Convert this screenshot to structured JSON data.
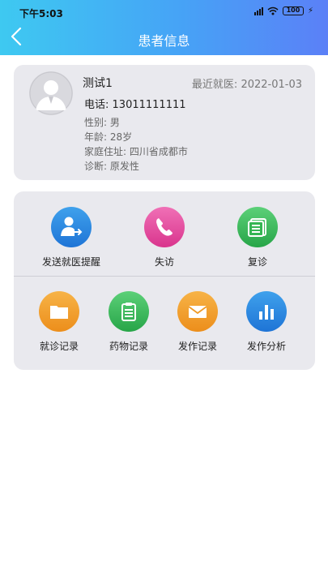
{
  "status_bar": {
    "time": "下午5:03",
    "battery": "100"
  },
  "header": {
    "title": "患者信息",
    "back_icon": "chevron-left-icon"
  },
  "patient": {
    "name": "测试1",
    "last_visit_label": "最近就医:",
    "last_visit_date": "2022-01-03",
    "phone_label": "电话:",
    "phone": "13011111111",
    "gender": "性别:  男",
    "age": "年龄:  28岁",
    "address": "家庭住址:  四川省成都市",
    "diagnosis": "诊断:  原发性"
  },
  "actions_row1": [
    {
      "label": "发送就医提醒",
      "icon": "person-send-icon",
      "color": "#2a86e0"
    },
    {
      "label": "失访",
      "icon": "phone-icon",
      "color": "#e44b9f"
    },
    {
      "label": "复诊",
      "icon": "document-list-icon",
      "color": "#3cba5c"
    }
  ],
  "actions_row2": [
    {
      "label": "就诊记录",
      "icon": "folder-icon",
      "color": "#f2a030"
    },
    {
      "label": "药物记录",
      "icon": "clipboard-icon",
      "color": "#3cba5c"
    },
    {
      "label": "发作记录",
      "icon": "envelope-icon",
      "color": "#f2a030"
    },
    {
      "label": "发作分析",
      "icon": "bar-chart-icon",
      "color": "#2a86e0"
    }
  ]
}
